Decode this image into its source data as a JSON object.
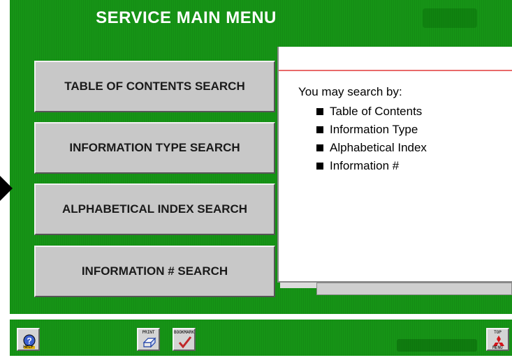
{
  "header": {
    "title": "SERVICE MAIN MENU"
  },
  "menu": {
    "buttons": [
      {
        "label": "TABLE OF CONTENTS SEARCH"
      },
      {
        "label": "INFORMATION TYPE SEARCH"
      },
      {
        "label": "ALPHABETICAL INDEX SEARCH"
      },
      {
        "label": "INFORMATION # SEARCH"
      }
    ]
  },
  "info": {
    "intro": "You may search by:",
    "items": [
      "Table of Contents",
      "Information Type",
      "Alphabetical Index",
      "Information #"
    ]
  },
  "toolbar": {
    "help_label": "HELP",
    "print_label": "PRINT",
    "bookmark_label": "BOOKMARK",
    "top_menu_label_1": "TOP",
    "top_menu_label_2": "MENU"
  },
  "colors": {
    "background_green": "#169416",
    "button_gray": "#c8c8c8",
    "panel_red_line": "#e86a6a"
  },
  "icons": {
    "help": "question-mark-icon",
    "print": "printer-icon",
    "bookmark": "checkmark-icon",
    "top_menu": "mitsubishi-logo-icon",
    "pointer": "arrow-right-icon"
  }
}
